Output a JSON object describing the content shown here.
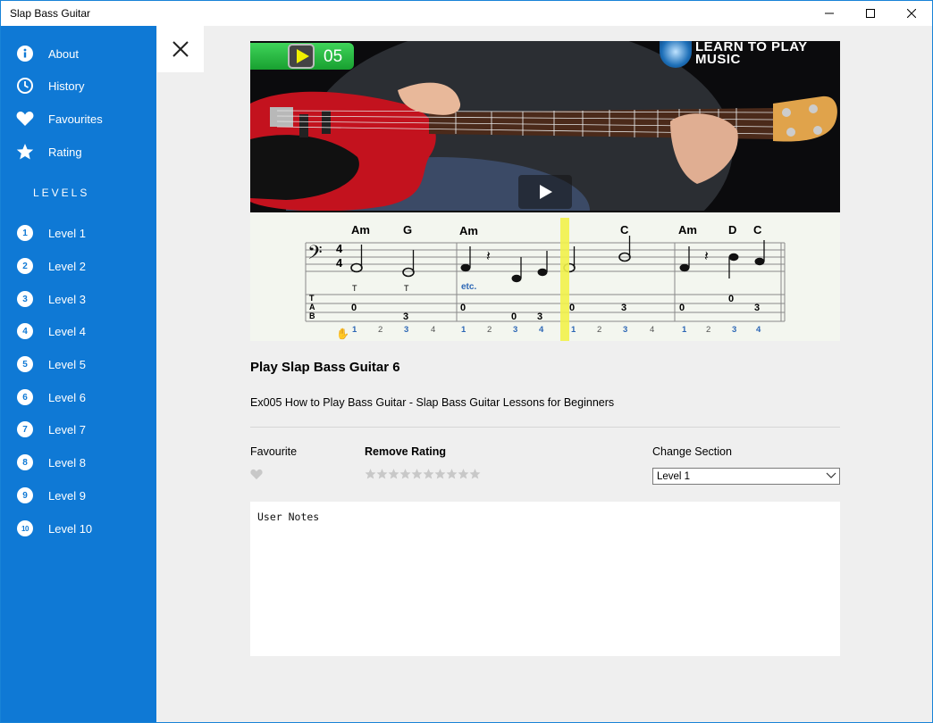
{
  "window": {
    "title": "Slap Bass Guitar"
  },
  "sidebar": {
    "menu": [
      {
        "label": "About",
        "icon": "info-icon"
      },
      {
        "label": "History",
        "icon": "clock-icon"
      },
      {
        "label": "Favourites",
        "icon": "heart-icon"
      },
      {
        "label": "Rating",
        "icon": "star-icon"
      }
    ],
    "levels_heading": "LEVELS",
    "levels": [
      {
        "num": "1",
        "label": "Level 1"
      },
      {
        "num": "2",
        "label": "Level 2"
      },
      {
        "num": "3",
        "label": "Level 3"
      },
      {
        "num": "4",
        "label": "Level 4"
      },
      {
        "num": "5",
        "label": "Level 5"
      },
      {
        "num": "6",
        "label": "Level 6"
      },
      {
        "num": "7",
        "label": "Level 7"
      },
      {
        "num": "8",
        "label": "Level 8"
      },
      {
        "num": "9",
        "label": "Level 9"
      },
      {
        "num": "10",
        "label": "Level 10"
      }
    ]
  },
  "video": {
    "counter": "05",
    "logo": "LEARN TO PLAY MUSIC",
    "chords": [
      "Am",
      "G",
      "Am",
      "C",
      "Am",
      "D",
      "C"
    ],
    "etc": "etc.",
    "time_signature": [
      "4",
      "4"
    ],
    "fingering_marks": [
      "T",
      "T"
    ],
    "tab_letters": [
      "T",
      "A",
      "B"
    ],
    "tab_numbers": [
      "0",
      "3",
      "0",
      "0",
      "3",
      "0",
      "3",
      "0",
      "0",
      "3"
    ],
    "beat_counts": [
      "1",
      "2",
      "3",
      "4",
      "1",
      "2",
      "3",
      "4",
      "1",
      "2",
      "3",
      "4",
      "1",
      "2",
      "3",
      "4"
    ]
  },
  "lesson": {
    "title": "Play Slap Bass Guitar 6",
    "description": "Ex005 How to Play Bass Guitar - Slap Bass Guitar Lessons for Beginners"
  },
  "controls": {
    "favourite_label": "Favourite",
    "rating_label": "Remove Rating",
    "rating_stars_total": 10,
    "rating_value": 0,
    "section_label": "Change Section",
    "section_selected": "Level 1"
  },
  "notes": {
    "value": "User Notes"
  },
  "colors": {
    "sidebar": "#0f79d5",
    "content_bg": "#efefef",
    "star_inactive": "#c8c8c8"
  }
}
